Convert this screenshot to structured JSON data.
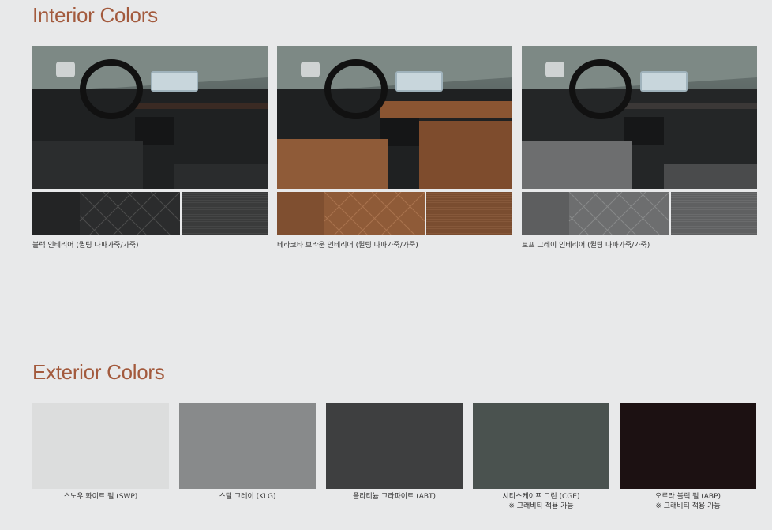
{
  "colors": {
    "title": "#a35a3d",
    "background": "#e8e9ea"
  },
  "interior": {
    "title": "Interior Colors",
    "items": [
      {
        "caption": "블랙 인테리어 (퀼팅 나파가죽/가죽)",
        "seat_color": "#2f3131",
        "fabric_color": "#3a3b3b",
        "leather_color": "#2b2c2d"
      },
      {
        "caption": "테라코타 브라운 인테리어 (퀼팅 나파가죽/가죽)",
        "seat_color": "#8a5532",
        "fabric_color": "#7a4d30",
        "leather_color": "#8f5b38"
      },
      {
        "caption": "토프 그레이 인테리어 (퀼팅 나파가죽/가죽)",
        "seat_color": "#6a6b6b",
        "fabric_color": "#5f6061",
        "leather_color": "#6d6e6f"
      }
    ]
  },
  "exterior": {
    "title": "Exterior Colors",
    "items": [
      {
        "caption": "스노우 화이트 펄 (SWP)",
        "note": "",
        "color": "#dcdddd"
      },
      {
        "caption": "스틸 그레이 (KLG)",
        "note": "",
        "color": "#888a8b"
      },
      {
        "caption": "플라티늄 그라파이트 (ABT)",
        "note": "",
        "color": "#3e3f40"
      },
      {
        "caption": "시티스케이프 그린 (CGE)",
        "note": "※ 그래비티 적용 가능",
        "color": "#4a524f"
      },
      {
        "caption": "오로라 블랙 펄 (ABP)",
        "note": "※ 그래비티 적용 가능",
        "color": "#1c1112"
      }
    ]
  }
}
